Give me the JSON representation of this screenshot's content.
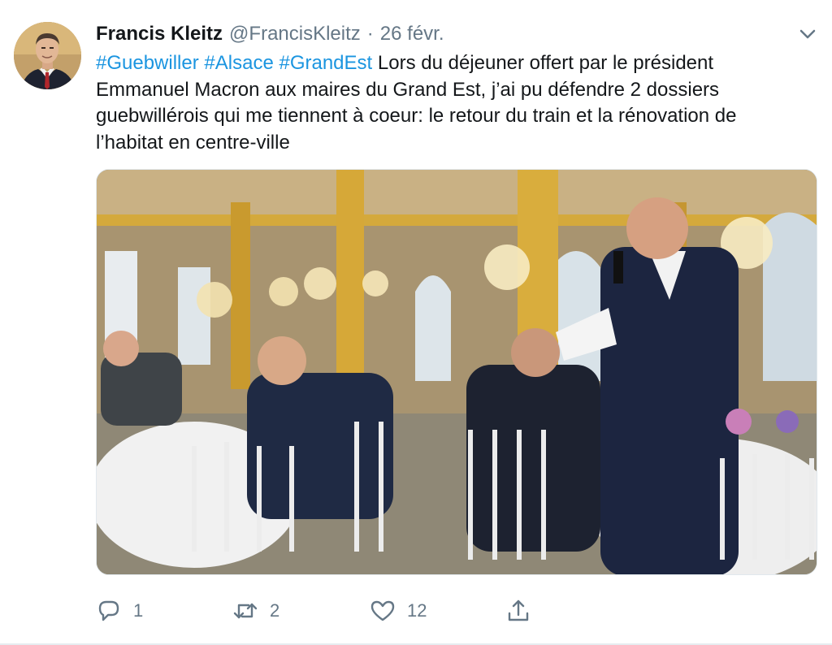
{
  "tweet": {
    "author_name": "Francis Kleitz",
    "handle": "@FrancisKleitz",
    "separator": "·",
    "date": "26 févr.",
    "hashtags": [
      "#Guebwiller",
      "#Alsace",
      "#GrandEst"
    ],
    "text_line1": "Lors du déjeuner offert par le président",
    "text_line2": "Emmanuel Macron aux maires du Grand Est, j’ai pu défendre 2 dossiers",
    "text_line3": "guebwillérois qui me tiennent à coeur: le retour du train et la rénovation de",
    "text_line4": "l’habitat en centre-ville",
    "link_color": "#1b95e0"
  },
  "actions": {
    "reply_count": "1",
    "retweet_count": "2",
    "like_count": "12"
  },
  "icons": {
    "more": "chevron-down-icon",
    "reply": "reply-icon",
    "retweet": "retweet-icon",
    "like": "heart-icon",
    "share": "share-icon"
  }
}
